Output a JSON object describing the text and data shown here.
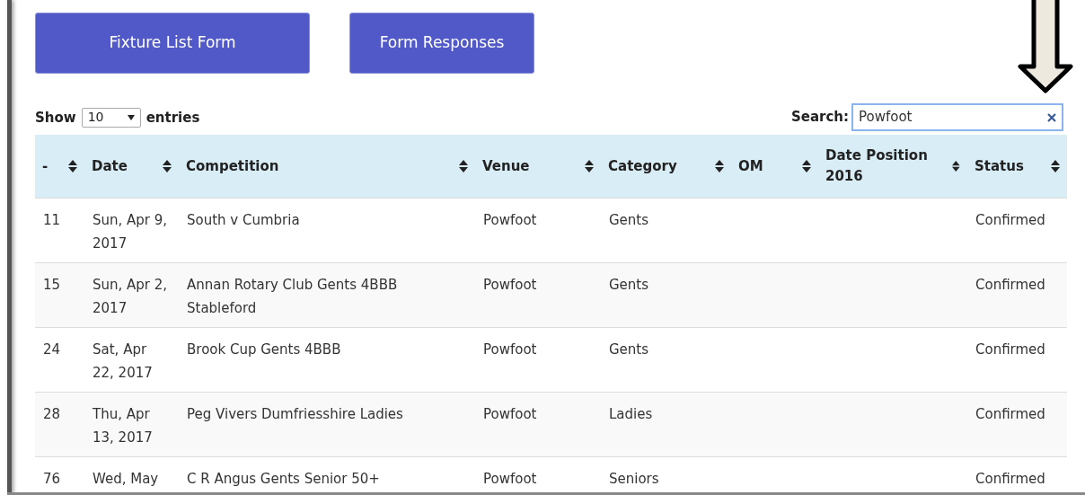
{
  "buttons": [
    "Fixture List Form",
    "Form Responses"
  ],
  "length": {
    "label_before": "Show",
    "value": "10",
    "label_after": "entries"
  },
  "search": {
    "label": "Search:",
    "value": "Powfoot"
  },
  "table": {
    "columns": [
      "-",
      "Date",
      "Competition",
      "Venue",
      "Category",
      "OM",
      "Date Position 2016",
      "Status"
    ],
    "rows": [
      [
        "11",
        "Sun, Apr 9, 2017",
        "South v Cumbria",
        "Powfoot",
        "Gents",
        "",
        "",
        "Confirmed"
      ],
      [
        "15",
        "Sun, Apr 2, 2017",
        "Annan Rotary Club Gents 4BBB Stableford",
        "Powfoot",
        "Gents",
        "",
        "",
        "Confirmed"
      ],
      [
        "24",
        "Sat, Apr 22, 2017",
        "Brook Cup Gents 4BBB",
        "Powfoot",
        "Gents",
        "",
        "",
        "Confirmed"
      ],
      [
        "28",
        "Thu, Apr 13, 2017",
        "Peg Vivers Dumfriesshire Ladies",
        "Powfoot",
        "Ladies",
        "",
        "",
        "Confirmed"
      ],
      [
        "76",
        "Wed, May",
        "C R Angus Gents Senior 50+",
        "Powfoot",
        "Seniors",
        "",
        "",
        "Confirmed"
      ]
    ]
  }
}
